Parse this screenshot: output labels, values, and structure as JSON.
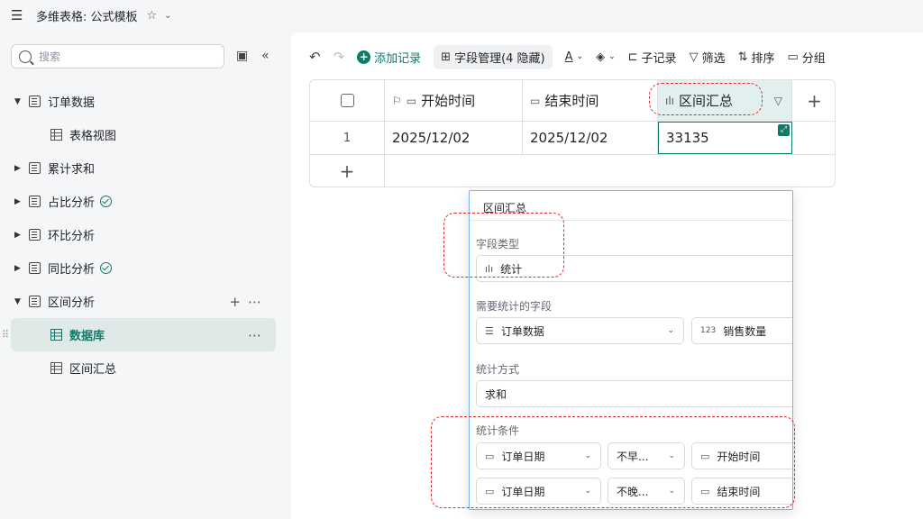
{
  "topbar": {
    "title": "多维表格: 公式模板"
  },
  "sidebar": {
    "search_placeholder": "搜索",
    "items": [
      {
        "label": "订单数据",
        "expanded": true
      },
      {
        "label": "表格视图"
      },
      {
        "label": "累计求和"
      },
      {
        "label": "占比分析"
      },
      {
        "label": "环比分析"
      },
      {
        "label": "同比分析"
      },
      {
        "label": "区间分析",
        "expanded": true
      },
      {
        "label": "数据库",
        "active": true
      },
      {
        "label": "区间汇总"
      }
    ]
  },
  "toolbar": {
    "add_record": "添加记录",
    "field_manage": "字段管理(4 隐藏)",
    "sub_record": "子记录",
    "filter": "筛选",
    "sort": "排序",
    "group": "分组"
  },
  "table": {
    "headers": [
      "开始时间",
      "结束时间",
      "区间汇总"
    ],
    "rows": [
      {
        "index": "1",
        "start": "2025/12/02",
        "end": "2025/12/02",
        "sum": "33135"
      }
    ]
  },
  "popup": {
    "field_name": "区间汇总",
    "field_type_label": "字段类型",
    "field_type_value": "统计",
    "stat_field_label": "需要统计的字段",
    "stat_table": "订单数据",
    "stat_field": "销售数量",
    "stat_field_icon_text": "123",
    "method_label": "统计方式",
    "method_value": "求和",
    "conditions_label": "统计条件",
    "conditions": [
      {
        "field": "订单日期",
        "op": "不早...",
        "value": "开始时间"
      },
      {
        "field": "订单日期",
        "op": "不晚...",
        "value": "结束时间"
      }
    ]
  },
  "colors": {
    "accent": "#0f7a6b",
    "annotation": "#e02b2b",
    "popup_border": "#7ab3f0"
  }
}
